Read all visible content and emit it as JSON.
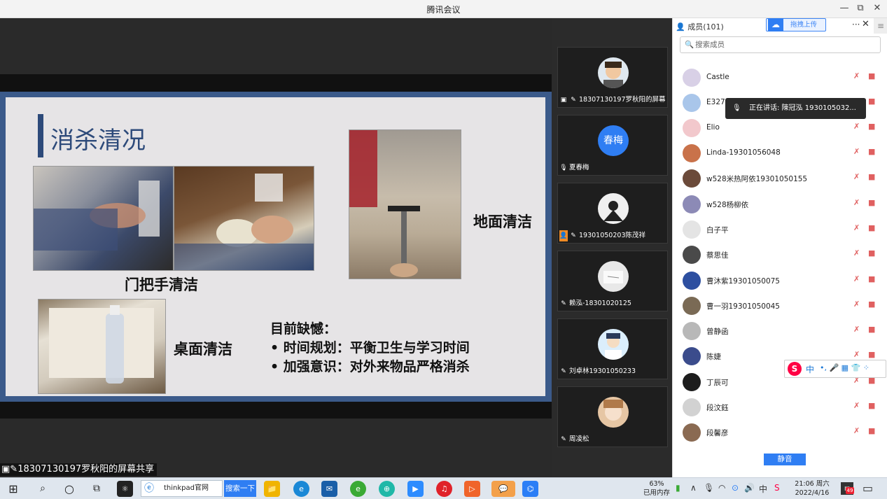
{
  "window": {
    "title": "腾讯会议",
    "minimize": "—",
    "restore": "⧉",
    "close": "✕"
  },
  "slide": {
    "title": "消杀清况",
    "label_door": "门把手清洁",
    "label_floor": "地面清洁",
    "label_desk": "桌面清洁",
    "bullets_heading": "目前缺憾：",
    "bullets": [
      "•  时间规划：平衡卫生与学习时间",
      "•  加强意识：对外来物品严格消杀"
    ]
  },
  "share_caption": "18307130197罗秋阳的屏幕共享",
  "videos": [
    {
      "name": "18307130197罗秋阳的屏幕...",
      "avatar_text": "",
      "avatar_color": "#dfe8ef"
    },
    {
      "name": "夏春梅",
      "avatar_text": "春梅",
      "avatar_color": "#2f7ef3"
    },
    {
      "name": "19301050203陈茂祥",
      "avatar_text": "",
      "avatar_color": "#f0f0f0"
    },
    {
      "name": "赖泓-18301020125",
      "avatar_text": "",
      "avatar_color": "#e8e8e8"
    },
    {
      "name": "刘卓林19301050233",
      "avatar_text": "",
      "avatar_color": "#dbeefc"
    },
    {
      "name": "周凌松",
      "avatar_text": "",
      "avatar_color": "#e6c6a4"
    }
  ],
  "panel": {
    "members_label": "成员(101)",
    "upload_label": "拖拽上传",
    "more_label": "···",
    "search_placeholder": "搜索成员",
    "speaking": "正在讲话: 陳冠泓 1930105032...",
    "mute_all": "静音",
    "members": [
      {
        "name": "Castle",
        "color": "#d8d0e6"
      },
      {
        "name": "E327",
        "color": "#a9c6ea"
      },
      {
        "name": "Elio",
        "color": "#f2c8cc"
      },
      {
        "name": "Linda-19301056048",
        "color": "#c9724a"
      },
      {
        "name": "w528米热阿依19301050155",
        "color": "#6b4a3a"
      },
      {
        "name": "w528杨柳依",
        "color": "#8c8ab6"
      },
      {
        "name": "白子平",
        "color": "#e4e4e4"
      },
      {
        "name": "蔡思佳",
        "color": "#4a4a4a"
      },
      {
        "name": "曹沐紫19301050075",
        "color": "#2d4fa0"
      },
      {
        "name": "曹一羽19301050045",
        "color": "#7a6a55"
      },
      {
        "name": "曾静函",
        "color": "#b8b8b8"
      },
      {
        "name": "陈婕",
        "color": "#3b4c8c"
      },
      {
        "name": "丁辰可",
        "color": "#1d1d1d"
      },
      {
        "name": "段汶鈺",
        "color": "#d2d2d2"
      },
      {
        "name": "段馨彦",
        "color": "#8a6a52"
      }
    ]
  },
  "ime": {
    "logo": "S",
    "lang": "中",
    "items": "•,  🎤  ▦  👕  ⁘"
  },
  "taskbar": {
    "start": "⊞",
    "search_icon": "⌕",
    "cortana": "○",
    "taskview": "⧉",
    "browser_field": "thinkpad官网",
    "search_button": "搜索一下",
    "memory_percent": "63%",
    "memory_label": "已用内存",
    "ime_lang": "中",
    "time": "21:06 周六",
    "date": "2022/4/16",
    "notification_count": "49"
  }
}
